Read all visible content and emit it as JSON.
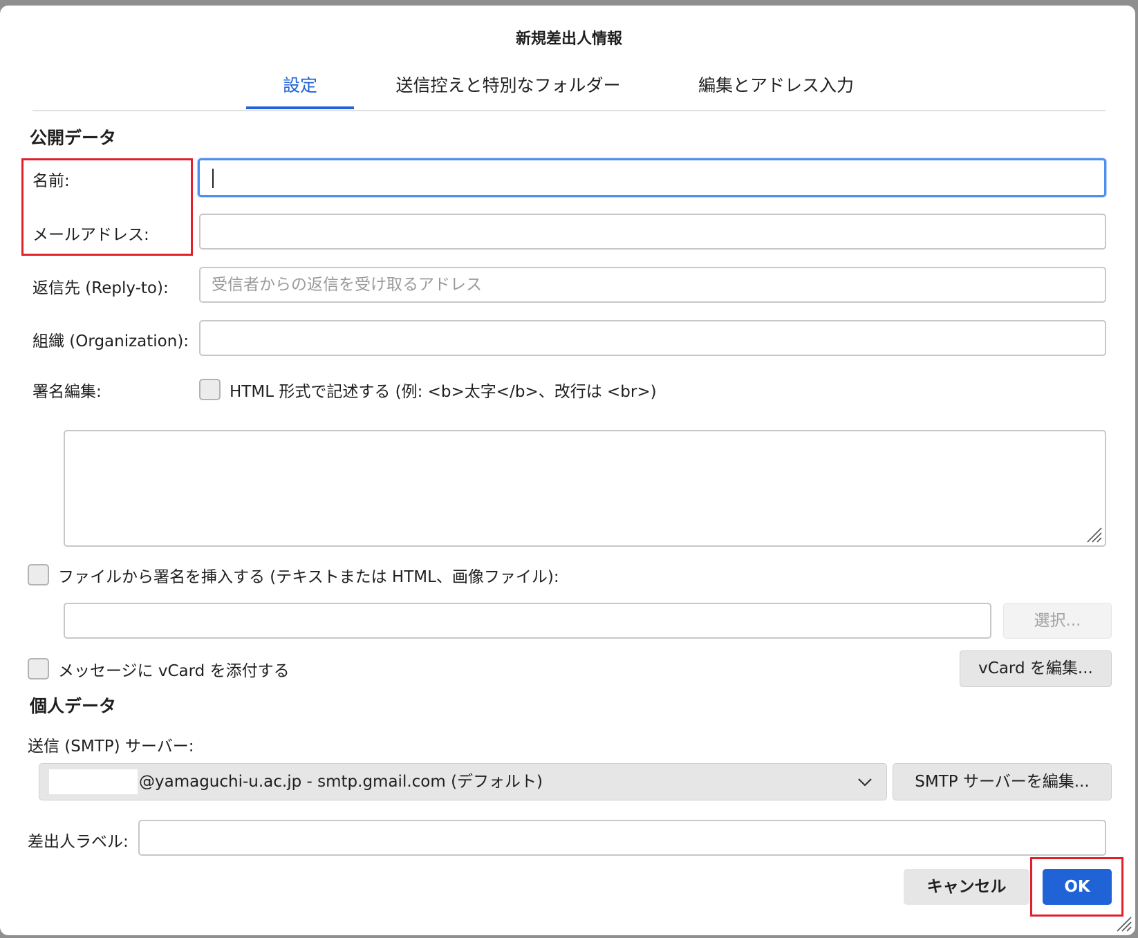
{
  "dialog": {
    "title": "新規差出人情報"
  },
  "tabs": [
    {
      "label": "設定",
      "active": true
    },
    {
      "label": "送信控えと特別なフォルダー",
      "active": false
    },
    {
      "label": "編集とアドレス入力",
      "active": false
    }
  ],
  "public": {
    "heading": "公開データ",
    "name_label": "名前:",
    "email_label": "メールアドレス:",
    "replyto_label": "返信先 (Reply-to):",
    "replyto_placeholder": "受信者からの返信を受け取るアドレス",
    "org_label": "組織 (Organization):",
    "sig_label": "署名編集:",
    "html_checkbox_label": "HTML 形式で記述する (例: <b>太字</b>、改行は <br>)",
    "file_sig_label": "ファイルから署名を挿入する (テキストまたは HTML、画像ファイル):",
    "choose_button": "選択...",
    "vcard_label": "メッセージに vCard を添付する",
    "vcard_edit_button": "vCard を編集..."
  },
  "private": {
    "heading": "個人データ",
    "smtp_label": "送信 (SMTP) サーバー:",
    "smtp_value": "@yamaguchi-u.ac.jp - smtp.gmail.com (デフォルト)",
    "smtp_edit_button": "SMTP サーバーを編集...",
    "sender_label_label": "差出人ラベル:"
  },
  "footer": {
    "cancel": "キャンセル",
    "ok": "OK"
  },
  "colors": {
    "accent": "#1f63d6",
    "highlight": "#e0202b"
  }
}
